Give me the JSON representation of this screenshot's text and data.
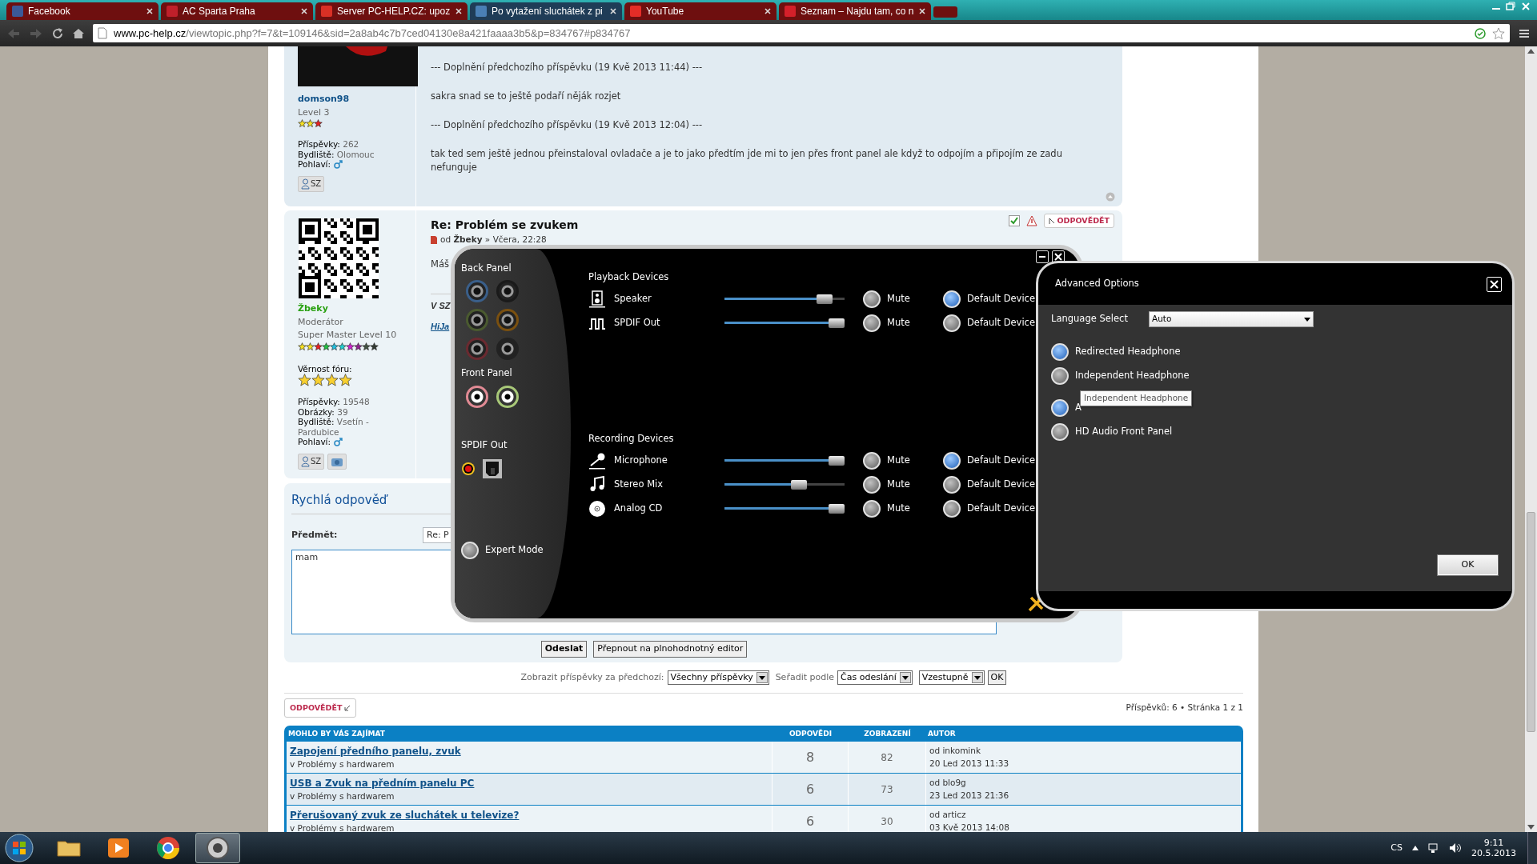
{
  "browser": {
    "tabs": [
      {
        "title": "Facebook",
        "color": "#3b5998",
        "selected": false
      },
      {
        "title": "AC Sparta Praha",
        "color": "#c0202a",
        "selected": false
      },
      {
        "title": "Server PC-HELP.CZ: upoz",
        "color": "#d93025",
        "selected": false
      },
      {
        "title": "Po vytažení sluchátek z pi",
        "color": "#4a7fb5",
        "selected": true
      },
      {
        "title": "YouTube",
        "color": "#e52d27",
        "selected": false
      },
      {
        "title": "Seznam – Najdu tam, co n",
        "color": "#d4202a",
        "selected": false
      }
    ],
    "address": {
      "host": "www.pc-help.cz",
      "path": "/viewtopic.php?f=7&t=109146&sid=2a8ab4c7b7ced04130e8a421faaaa3b5&p=834767#p834767"
    }
  },
  "posts": [
    {
      "kind": "member",
      "author": "domson98",
      "rank": "Level 3",
      "stats": [
        {
          "label": "Příspěvky:",
          "value": "262"
        },
        {
          "label": "Bydliště:",
          "value": "Olomouc"
        },
        {
          "label": "Pohlaví:"
        }
      ],
      "pm_button": "SZ",
      "body": [
        {
          "kind": "text",
          "text": "--- Doplnění předchozího příspěvku (19 Kvě 2013 11:44) ---"
        },
        {
          "kind": "text",
          "text": "sakra snad se to ještě podaří něják rozjet"
        },
        {
          "kind": "text",
          "text": "--- Doplnění předchozího příspěvku (19 Kvě 2013 12:04) ---"
        },
        {
          "kind": "text",
          "text": "tak ted sem ještě jednou přeinstaloval ovladače a je to jako předtím jde mi to jen přes front panel ale když to odpojím a připojím ze zadu nefunguje"
        }
      ]
    },
    {
      "title": "Re: Problém se zvukem",
      "meta": {
        "prefix": "od",
        "author": "Žbeky",
        "suffix": "» Včera, 22:28"
      },
      "reply_button": "ODPOVĚDĚT",
      "author": "Žbeky",
      "role": "Moderátor",
      "rank": "Super Master Level 10",
      "kind": "moderator",
      "loyalty_label": "Věrnost fóru:",
      "loyalty": {
        "stars": 4
      },
      "stats": [
        {
          "label": "Příspěvky:",
          "value": "19548"
        },
        {
          "label": "Obrázky:",
          "value": "39"
        },
        {
          "label": "Bydliště:",
          "value": "Vsetín - Pardubice"
        },
        {
          "label": "Pohlaví:"
        }
      ],
      "pm_button": "SZ",
      "body": [
        {
          "kind": "text",
          "text": "Máš"
        },
        {
          "kind": "heading",
          "text": "V SZ"
        },
        {
          "kind": "link",
          "text": "HiJa"
        }
      ]
    }
  ],
  "quick_reply": {
    "title": "Rychlá odpověď",
    "subject_label": "Předmět:",
    "subject": "Re: P",
    "message": "mam",
    "buttons": [
      "Odeslat",
      "Přepnout na plnohodnotný editor"
    ]
  },
  "display_options": {
    "show_label": "Zobrazit příspěvky za předchozí:",
    "show_value": "Všechny příspěvky",
    "sort_label": "Seřadit podle",
    "sort_value": "Čas odeslání",
    "order_value": "Vzestupně",
    "go": "OK"
  },
  "reply_button": "ODPOVĚDĚT",
  "pagination": "Příspěvků: 6 • Stránka 1 z 1",
  "related_topics": {
    "columns": [
      "MOHLO BY VÁS ZAJÍMAT",
      "ODPOVĚDI",
      "ZOBRAZENÍ",
      "AUTOR"
    ],
    "rows": [
      {
        "title": "Zapojení předního panelu, zvuk",
        "forum": "v Problémy s hardwarem",
        "replies": "8",
        "views": "82",
        "author": "od inkomink",
        "date": "20 Led 2013 11:33"
      },
      {
        "title": "USB a Zvuk na předním panelu PC",
        "forum": "v Problémy s hardwarem",
        "replies": "6",
        "views": "73",
        "author": "od blo9g",
        "date": "23 Led 2013 21:36"
      },
      {
        "title": "Přerušovaný zvuk ze sluchátek u televize?",
        "forum": "v Problémy s hardwarem",
        "replies": "6",
        "views": "30",
        "author": "od articz",
        "date": "03 Kvě 2013 14:08"
      }
    ]
  },
  "audio_manager": {
    "back_panel_label": "Back Panel",
    "back_jacks": [
      {
        "color": "#3a5f8a",
        "connected": false
      },
      {
        "color": "#1a1a1a",
        "connected": false
      },
      {
        "color": "#4a5a30",
        "connected": false
      },
      {
        "color": "#7a5010",
        "connected": false
      },
      {
        "color": "#6a2a30",
        "connected": false
      },
      {
        "color": "#222222",
        "connected": false
      }
    ],
    "front_panel_label": "Front Panel",
    "front_jacks": [
      {
        "color": "#e08a94",
        "connected": true
      },
      {
        "color": "#a8c878",
        "connected": true
      }
    ],
    "spdif_label": "SPDIF Out",
    "expert_mode": {
      "label": "Expert Mode",
      "on": false
    },
    "playback_title": "Playback Devices",
    "playback": [
      {
        "name": "Speaker",
        "kind": "speaker",
        "level": 0.83,
        "muted": false,
        "default": true,
        "mute_label": "Mute",
        "default_label": "Default Device"
      },
      {
        "name": "SPDIF Out",
        "kind": "spdif",
        "level": 0.93,
        "muted": false,
        "default": false,
        "mute_label": "Mute",
        "default_label": "Default Device"
      }
    ],
    "recording_title": "Recording Devices",
    "recording": [
      {
        "name": "Microphone",
        "kind": "microphone",
        "level": 0.93,
        "muted": false,
        "default": true,
        "mute_label": "Mute",
        "default_label": "Default Device"
      },
      {
        "name": "Stereo Mix",
        "kind": "note",
        "level": 0.62,
        "muted": false,
        "default": false,
        "mute_label": "Mute",
        "default_label": "Default Device"
      },
      {
        "name": "Analog CD",
        "kind": "cd",
        "level": 0.93,
        "muted": false,
        "default": false,
        "mute_label": "Mute",
        "default_label": "Default Device"
      }
    ]
  },
  "advanced_options": {
    "title": "Advanced Options",
    "language_label": "Language Select",
    "language": "Auto",
    "options": [
      {
        "label": "Redirected Headphone",
        "selected": true
      },
      {
        "label": "Independent Headphone",
        "selected": false
      },
      {
        "label": "A",
        "selected": true
      },
      {
        "label": "HD Audio Front Panel",
        "selected": false
      }
    ],
    "tooltip": "Independent Headphone",
    "ok": "OK"
  },
  "taskbar": {
    "items": [
      {
        "kind": "folder",
        "selected": false
      },
      {
        "kind": "player",
        "selected": false
      },
      {
        "kind": "browser",
        "selected": false
      },
      {
        "kind": "audio",
        "selected": true
      }
    ],
    "language": "CS",
    "time": "9:11",
    "date": "20.5.2013"
  }
}
